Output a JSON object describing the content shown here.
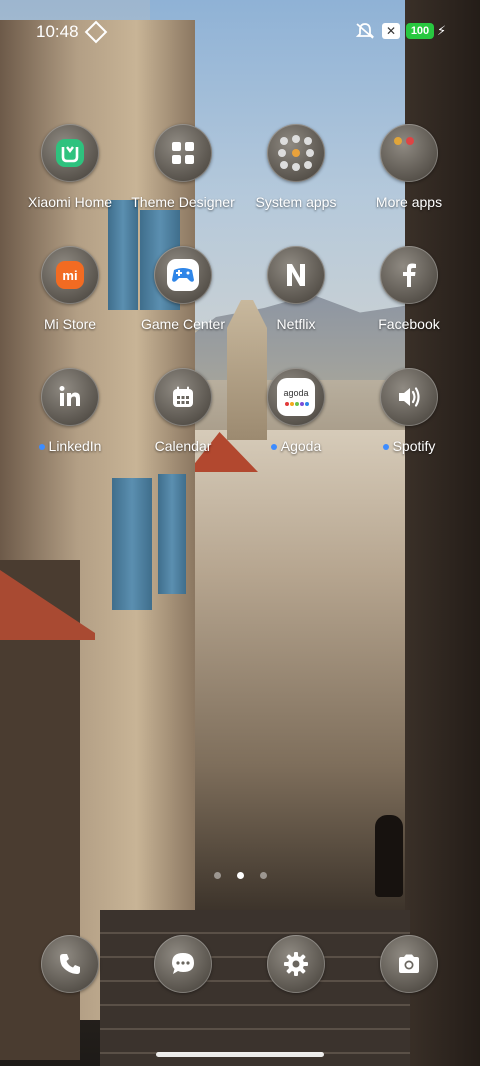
{
  "status_bar": {
    "time": "10:48",
    "battery_level": "100",
    "battery_color": "#28c840",
    "icons": [
      "diamond-icon",
      "mute-icon",
      "x-notification-icon",
      "battery-icon",
      "charging-bolt-icon"
    ]
  },
  "apps": [
    {
      "label": "Xiaomi Home",
      "icon": "xiaomi-home-icon",
      "has_dot": false
    },
    {
      "label": "Theme Designer",
      "icon": "grid-squares-icon",
      "has_dot": false
    },
    {
      "label": "System apps",
      "icon": "folder-icon",
      "has_dot": false
    },
    {
      "label": "More apps",
      "icon": "folder-icon",
      "has_dot": false
    },
    {
      "label": "Mi Store",
      "icon": "mi-store-icon",
      "has_dot": false
    },
    {
      "label": "Game Center",
      "icon": "gamepad-icon",
      "has_dot": false
    },
    {
      "label": "Netflix",
      "icon": "netflix-n-icon",
      "has_dot": false
    },
    {
      "label": "Facebook",
      "icon": "facebook-f-icon",
      "has_dot": false
    },
    {
      "label": "LinkedIn",
      "icon": "linkedin-icon",
      "has_dot": true
    },
    {
      "label": "Calendar",
      "icon": "calendar-icon",
      "has_dot": false
    },
    {
      "label": "Agoda",
      "icon": "agoda-icon",
      "has_dot": true
    },
    {
      "label": "Spotify",
      "icon": "speaker-icon",
      "has_dot": true
    }
  ],
  "agoda_text": "agoda",
  "pager": {
    "pages": 3,
    "active": 2
  },
  "dock": [
    "phone-icon",
    "messages-icon",
    "settings-icon",
    "camera-icon"
  ],
  "notification_dot_color": "#3d8cff"
}
